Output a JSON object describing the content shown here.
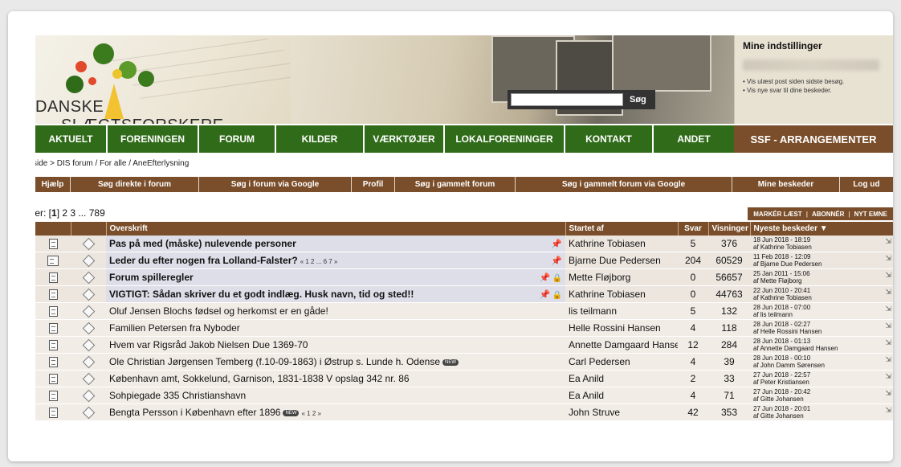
{
  "logo": {
    "word1": "DANSKE",
    "word2": "SLÆGTSFORSKERE"
  },
  "search": {
    "placeholder": "",
    "button": "Søg"
  },
  "settings": {
    "title": "Mine indstillinger",
    "bullets": [
      "Vis ulæst post siden sidste besøg.",
      "Vis nye svar til dine beskeder."
    ]
  },
  "mainnav": [
    "AKTUELT",
    "FORENINGEN",
    "FORUM",
    "KILDER",
    "VÆRKTØJER",
    "LOKALFORENINGER",
    "KONTAKT",
    "ANDET"
  ],
  "ssf": "SSF - ARRANGEMENTER",
  "breadcrumb": "Forside > DIS forum / For alle / AneEfterlysning",
  "subnav": [
    "Hjælp",
    "Søg direkte i forum",
    "Søg i forum via Google",
    "Profil",
    "Søg i gammelt forum",
    "Søg i gammelt forum via Google",
    "Mine beskeder",
    "Log ud"
  ],
  "pages": {
    "prefix": "Sider: [",
    "current": "1",
    "rest": "] 2 3 ... 789"
  },
  "actions": [
    "MARKÉR LÆST",
    "ABONNÉR",
    "NYT EMNE"
  ],
  "columns": {
    "title": "Overskrift",
    "started_by": "Startet af",
    "replies": "Svar",
    "views": "Visninger",
    "latest": "Nyeste beskeder ▼"
  },
  "topics": [
    {
      "title": "Pas på med (måske) nulevende personer",
      "sticky": true,
      "pages": "",
      "pin": true,
      "lock": false,
      "badge": "",
      "by": "Kathrine Tobiasen",
      "replies": "5",
      "views": "376",
      "date": "18 Jun 2018 - 18:19",
      "latest_by": "af Kathrine Tobiasen"
    },
    {
      "title": "Leder du efter nogen fra Lolland-Falster?",
      "sticky": true,
      "pages": "« 1 2 ... 6 7 »",
      "pin": true,
      "lock": false,
      "badge": "",
      "by": "Bjarne Due Pedersen",
      "replies": "204",
      "views": "60529",
      "date": "11 Feb 2018 - 12:09",
      "latest_by": "af Bjarne Due Pedersen"
    },
    {
      "title": "Forum spilleregler",
      "sticky": true,
      "pages": "",
      "pin": true,
      "lock": true,
      "badge": "",
      "by": "Mette Fløjborg",
      "replies": "0",
      "views": "56657",
      "date": "25 Jan 2011 - 15:06",
      "latest_by": "af Mette Fløjborg"
    },
    {
      "title": "VIGTIGT: Sådan skriver du et godt indlæg. Husk navn, tid og sted!!",
      "sticky": true,
      "pages": "",
      "pin": true,
      "lock": true,
      "badge": "",
      "by": "Kathrine Tobiasen",
      "replies": "0",
      "views": "44763",
      "date": "22 Jun 2010 - 20:41",
      "latest_by": "af Kathrine Tobiasen"
    },
    {
      "title": "Oluf Jensen Blochs fødsel og herkomst er en gåde!",
      "sticky": false,
      "pages": "",
      "pin": false,
      "lock": false,
      "badge": "",
      "by": "lis teilmann",
      "replies": "5",
      "views": "132",
      "date": "28 Jun 2018 - 07:00",
      "latest_by": "af lis teilmann"
    },
    {
      "title": "Familien Petersen fra Nyboder",
      "sticky": false,
      "pages": "",
      "pin": false,
      "lock": false,
      "badge": "",
      "by": "Helle Rossini Hansen",
      "replies": "4",
      "views": "118",
      "date": "28 Jun 2018 - 02:27",
      "latest_by": "af Helle Rossini Hansen"
    },
    {
      "title": "Hvem var Rigsråd Jakob Nielsen Due 1369-70",
      "sticky": false,
      "pages": "",
      "pin": false,
      "lock": false,
      "badge": "",
      "by": "Annette Damgaard Hansen",
      "replies": "12",
      "views": "284",
      "date": "28 Jun 2018 - 01:13",
      "latest_by": "af Annette Damgaard Hansen"
    },
    {
      "title": "Ole Christian Jørgensen Temberg (f.10-09-1863) i Østrup s. Lunde h. Odense",
      "sticky": false,
      "pages": "",
      "pin": false,
      "lock": false,
      "badge": "NEW",
      "by": "Carl Pedersen",
      "replies": "4",
      "views": "39",
      "date": "28 Jun 2018 - 00:10",
      "latest_by": "af John Damm Sørensen"
    },
    {
      "title": "København amt, Sokkelund, Garnison, 1831-1838 V opslag 342 nr. 86",
      "sticky": false,
      "pages": "",
      "pin": false,
      "lock": false,
      "badge": "",
      "by": "Ea Anild",
      "replies": "2",
      "views": "33",
      "date": "27 Jun 2018 - 22:57",
      "latest_by": "af Peter Kristiansen"
    },
    {
      "title": "Sohpiegade 335 Christianshavn",
      "sticky": false,
      "pages": "",
      "pin": false,
      "lock": false,
      "badge": "",
      "by": "Ea Anild",
      "replies": "4",
      "views": "71",
      "date": "27 Jun 2018 - 20:42",
      "latest_by": "af Gitte Johansen"
    },
    {
      "title": "Bengta Persson i København efter 1896",
      "sticky": false,
      "pages": "« 1 2 »",
      "pin": false,
      "lock": false,
      "badge": "NEW",
      "by": "John Struve",
      "replies": "42",
      "views": "353",
      "date": "27 Jun 2018 - 20:01",
      "latest_by": "af Gitte Johansen"
    }
  ]
}
